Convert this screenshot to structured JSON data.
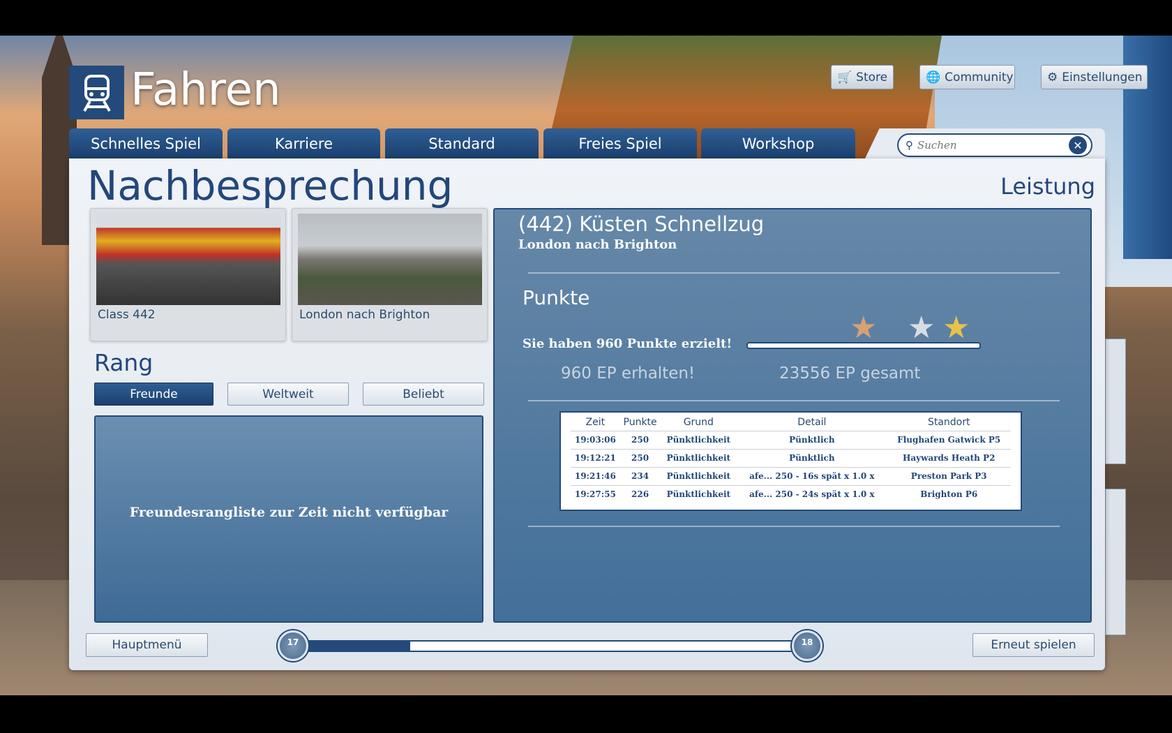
{
  "header": {
    "title": "Fahren",
    "logo_icon": "train-icon"
  },
  "top_buttons": [
    {
      "label": "Store",
      "icon": "cart-icon"
    },
    {
      "label": "Community",
      "icon": "globe-icon"
    },
    {
      "label": "Einstellungen",
      "icon": "gear-icon"
    }
  ],
  "tabs": [
    {
      "label": "Schnelles Spiel"
    },
    {
      "label": "Karriere"
    },
    {
      "label": "Standard"
    },
    {
      "label": "Freies Spiel"
    },
    {
      "label": "Workshop"
    }
  ],
  "search": {
    "placeholder": "Suchen",
    "value": ""
  },
  "page": {
    "title": "Nachbesprechung",
    "section": "Leistung"
  },
  "cards": [
    {
      "caption": "Class 442"
    },
    {
      "caption": "London nach Brighton"
    }
  ],
  "rank": {
    "title": "Rang",
    "buttons": [
      {
        "label": "Freunde",
        "active": true
      },
      {
        "label": "Weltweit"
      },
      {
        "label": "Beliebt"
      }
    ],
    "message": "Freundesrangliste zur Zeit nicht verfügbar"
  },
  "result": {
    "service": "(442) Küsten Schnellzug",
    "route": "London nach Brighton",
    "points_title": "Punkte",
    "points_text": "Sie haben 960 Punkte erzielt!",
    "ep_earned": "960 EP erhalten!",
    "ep_total": "23556 EP gesamt",
    "stars": [
      "bronze",
      "silver",
      "gold"
    ],
    "table": {
      "headers": [
        "Zeit",
        "Punkte",
        "Grund",
        "Detail",
        "Standort"
      ],
      "rows": [
        [
          "19:03:06",
          "250",
          "Pünktlichkeit",
          "Pünktlich",
          "Flughafen Gatwick P5"
        ],
        [
          "19:12:21",
          "250",
          "Pünktlichkeit",
          "Pünktlich",
          "Haywards Heath P2"
        ],
        [
          "19:21:46",
          "234",
          "Pünktlichkeit",
          "afe...   250 - 16s spät x 1.0 x",
          "Preston Park P3"
        ],
        [
          "19:27:55",
          "226",
          "Pünktlichkeit",
          "afe...   250 - 24s spät x 1.0 x",
          "Brighton P6"
        ]
      ]
    }
  },
  "footer": {
    "main_menu": "Hauptmenü",
    "replay": "Erneut spielen",
    "level_from": "17",
    "level_to": "18",
    "level_progress": 0.21
  },
  "colors": {
    "accent": "#234a7a",
    "panel": "#4f789f"
  }
}
